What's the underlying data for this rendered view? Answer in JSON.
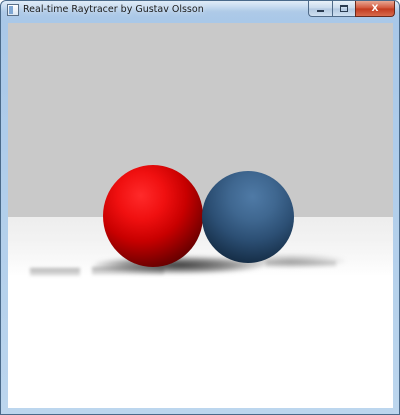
{
  "window": {
    "title": "Real-time Raytracer by Gustav Olsson",
    "close_glyph": "X"
  },
  "icons": {
    "app": "application-icon",
    "minimize": "minimize-icon",
    "maximize": "maximize-icon",
    "close": "close-icon"
  },
  "scene": {
    "wall_color": "#c9c9c9",
    "floor_color": "#ffffff",
    "spheres": [
      {
        "name": "red-sphere",
        "color": "#e00000"
      },
      {
        "name": "blue-sphere",
        "color": "#3a6591"
      }
    ]
  }
}
